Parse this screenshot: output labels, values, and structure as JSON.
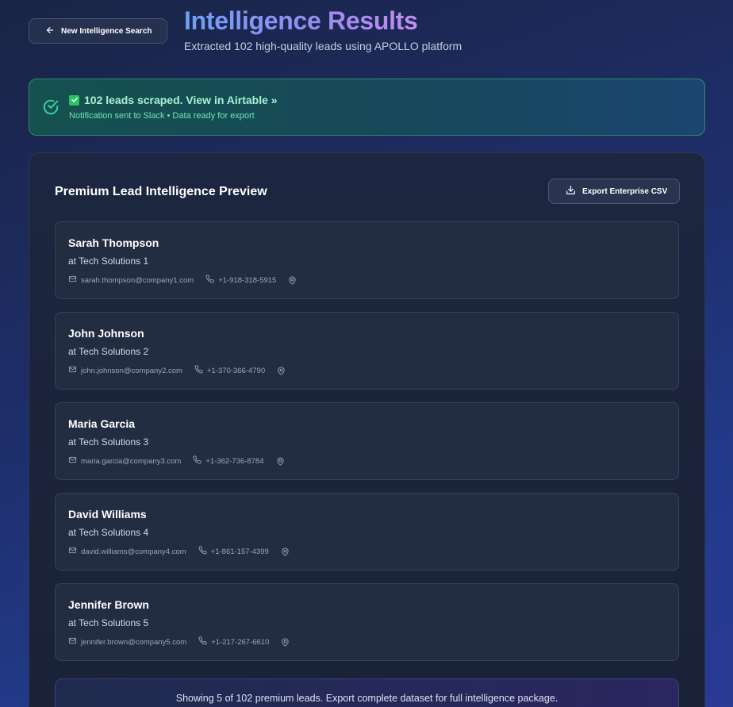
{
  "header": {
    "back_label": "New Intelligence Search",
    "title": "Intelligence Results",
    "subtitle": "Extracted 102 high-quality leads using APOLLO platform"
  },
  "alert": {
    "headline": "102 leads scraped. View in Airtable »",
    "note": "Notification sent to Slack • Data ready for export",
    "icons": [
      "circle-check-icon",
      "checkbox-icon"
    ]
  },
  "panel": {
    "title": "Premium Lead Intelligence Preview",
    "export_label": "Export Enterprise CSV"
  },
  "leads": [
    {
      "name": "Sarah Thompson",
      "company": "at Tech Solutions 1",
      "email": "sarah.thompson@company1.com",
      "phone": "+1-918-318-5915"
    },
    {
      "name": "John Johnson",
      "company": "at Tech Solutions 2",
      "email": "john.johnson@company2.com",
      "phone": "+1-370-366-4790"
    },
    {
      "name": "Maria Garcia",
      "company": "at Tech Solutions 3",
      "email": "maria.garcia@company3.com",
      "phone": "+1-362-736-8784"
    },
    {
      "name": "David Williams",
      "company": "at Tech Solutions 4",
      "email": "david.williams@company4.com",
      "phone": "+1-861-157-4399"
    },
    {
      "name": "Jennifer Brown",
      "company": "at Tech Solutions 5",
      "email": "jennifer.brown@company5.com",
      "phone": "+1-217-267-6610"
    }
  ],
  "footer": {
    "note": "Showing 5 of 102 premium leads. Export complete dataset for full intelligence package."
  },
  "colors": {
    "accent_green": "#22c55e",
    "title_gradient_start": "#6ea0f5",
    "title_gradient_end": "#c48ef0"
  }
}
